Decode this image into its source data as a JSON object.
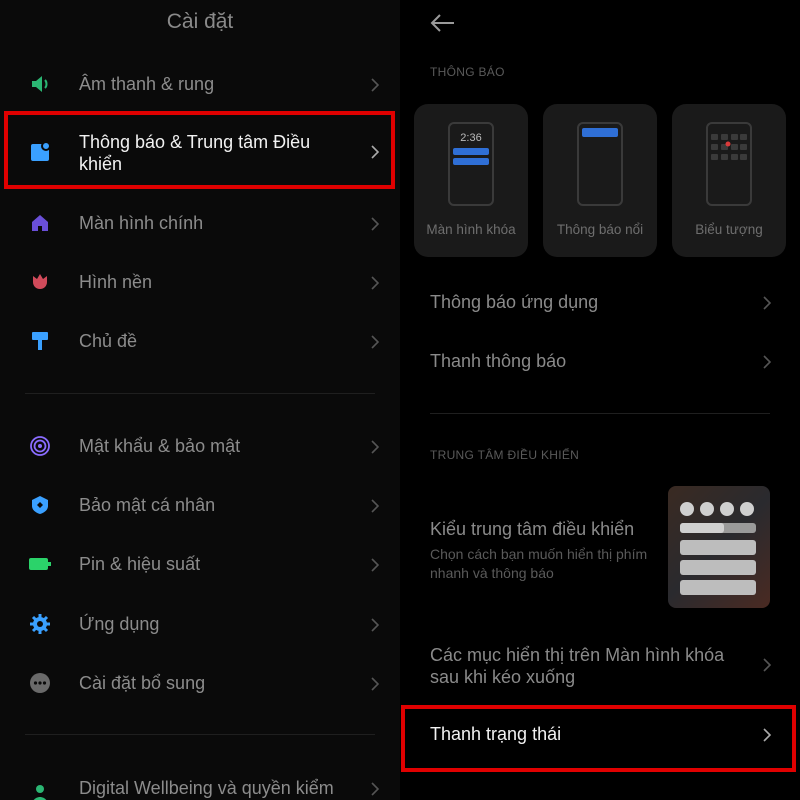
{
  "left": {
    "title": "Cài đặt",
    "items": [
      {
        "label": "Âm thanh & rung",
        "icon": "speaker-icon",
        "color": "#2bb673"
      },
      {
        "label_line1": "Thông báo & Trung tâm Điều",
        "label_line2": "khiển",
        "icon": "notification-icon",
        "color": "#3aa0ff"
      },
      {
        "label": "Màn hình chính",
        "icon": "home-icon",
        "color": "#6a4fd8"
      },
      {
        "label": "Hình nền",
        "icon": "tulip-icon",
        "color": "#d04a5a"
      },
      {
        "label": "Chủ đề",
        "icon": "paint-roller-icon",
        "color": "#3aa0ff"
      },
      {
        "label": "Mật khẩu & bảo mật",
        "icon": "fingerprint-icon",
        "color": "#8a6cff"
      },
      {
        "label": "Bảo mật cá nhân",
        "icon": "shield-icon",
        "color": "#3aa0ff"
      },
      {
        "label": "Pin & hiệu suất",
        "icon": "battery-icon",
        "color": "#2bd36a"
      },
      {
        "label": "Ứng dụng",
        "icon": "gear-icon",
        "color": "#3aa0ff"
      },
      {
        "label": "Cài đặt bổ sung",
        "icon": "more-dots-icon",
        "color": "#8a8a8a"
      },
      {
        "label": "Digital Wellbeing và quyền kiểm",
        "icon": "wellbeing-icon",
        "color": "#2bb673"
      }
    ]
  },
  "right": {
    "section_notifications": "THÔNG BÁO",
    "cards": [
      {
        "caption": "Màn hình khóa",
        "time": "2:36"
      },
      {
        "caption": "Thông báo nổi"
      },
      {
        "caption": "Biểu tượng"
      }
    ],
    "rows": [
      {
        "label": "Thông báo ứng dụng"
      },
      {
        "label": "Thanh thông báo"
      }
    ],
    "section_control": "TRUNG TÂM ĐIỀU KHIỂN",
    "control_style": {
      "title": "Kiểu trung tâm điều khiển",
      "subtitle": "Chọn cách bạn muốn hiển thị phím nhanh và thông báo"
    },
    "lockscreen_row": {
      "line1": "Các mục hiển thị trên Màn hình khóa",
      "line2": "sau khi kéo xuống"
    },
    "status_bar_row": {
      "label": "Thanh trạng thái"
    }
  },
  "colors": {
    "highlight": "#e00000",
    "accent": "#2f6fd6"
  }
}
